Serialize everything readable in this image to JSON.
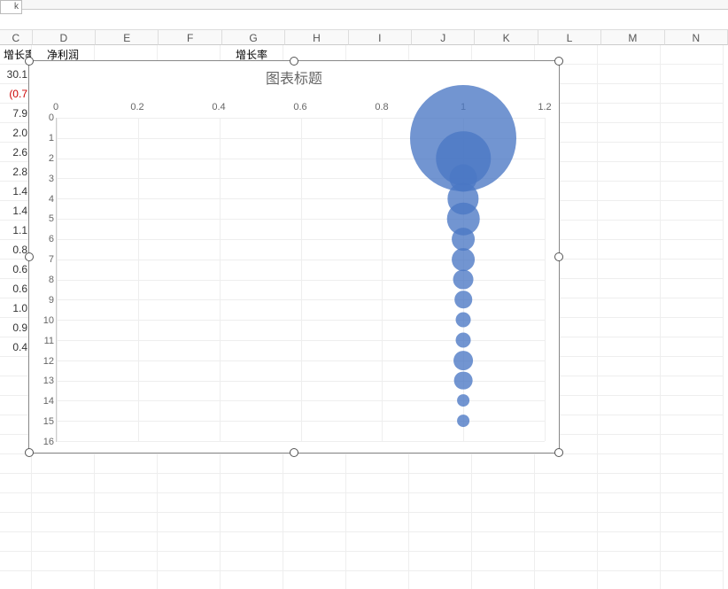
{
  "toolbar_stub": "k",
  "columns": [
    "C",
    "D",
    "E",
    "F",
    "G",
    "H",
    "I",
    "J",
    "K",
    "L",
    "M",
    "N"
  ],
  "sheet_headers": {
    "C": "增长率",
    "D": "净利润",
    "G": "增长率"
  },
  "col_c_values": [
    "30.1",
    "(0.7",
    "7.9",
    "2.0",
    "2.6",
    "2.8",
    "1.4",
    "1.4",
    "1.1",
    "0.8",
    "0.6",
    "0.6",
    "1.0",
    "0.9",
    "0.4"
  ],
  "col_c_red_index": 1,
  "chart": {
    "title": "图表标题",
    "x_ticks": [
      "0",
      "0.2",
      "0.4",
      "0.6",
      "0.8",
      "1",
      "1.2"
    ],
    "y_ticks": [
      "0",
      "1",
      "2",
      "3",
      "4",
      "5",
      "6",
      "7",
      "8",
      "9",
      "10",
      "11",
      "12",
      "13",
      "14",
      "15",
      "16"
    ]
  },
  "chart_data": {
    "type": "bubble",
    "title": "图表标题",
    "xlabel": "",
    "ylabel": "",
    "xlim": [
      0,
      1.2
    ],
    "ylim_inverted": true,
    "ylim": [
      0,
      16
    ],
    "series": [
      {
        "name": "",
        "points": [
          {
            "x": 1,
            "y": 1,
            "size": 30.1
          },
          {
            "x": 1,
            "y": 2,
            "size": 7.9
          },
          {
            "x": 1,
            "y": 3,
            "size": 2.0
          },
          {
            "x": 1,
            "y": 4,
            "size": 2.6
          },
          {
            "x": 1,
            "y": 5,
            "size": 2.8
          },
          {
            "x": 1,
            "y": 6,
            "size": 1.4
          },
          {
            "x": 1,
            "y": 7,
            "size": 1.4
          },
          {
            "x": 1,
            "y": 8,
            "size": 1.1
          },
          {
            "x": 1,
            "y": 9,
            "size": 0.8
          },
          {
            "x": 1,
            "y": 10,
            "size": 0.6
          },
          {
            "x": 1,
            "y": 11,
            "size": 0.6
          },
          {
            "x": 1,
            "y": 12,
            "size": 1.0
          },
          {
            "x": 1,
            "y": 13,
            "size": 0.9
          },
          {
            "x": 1,
            "y": 14,
            "size": 0.4
          },
          {
            "x": 1,
            "y": 15,
            "size": 0.4
          }
        ]
      }
    ]
  }
}
